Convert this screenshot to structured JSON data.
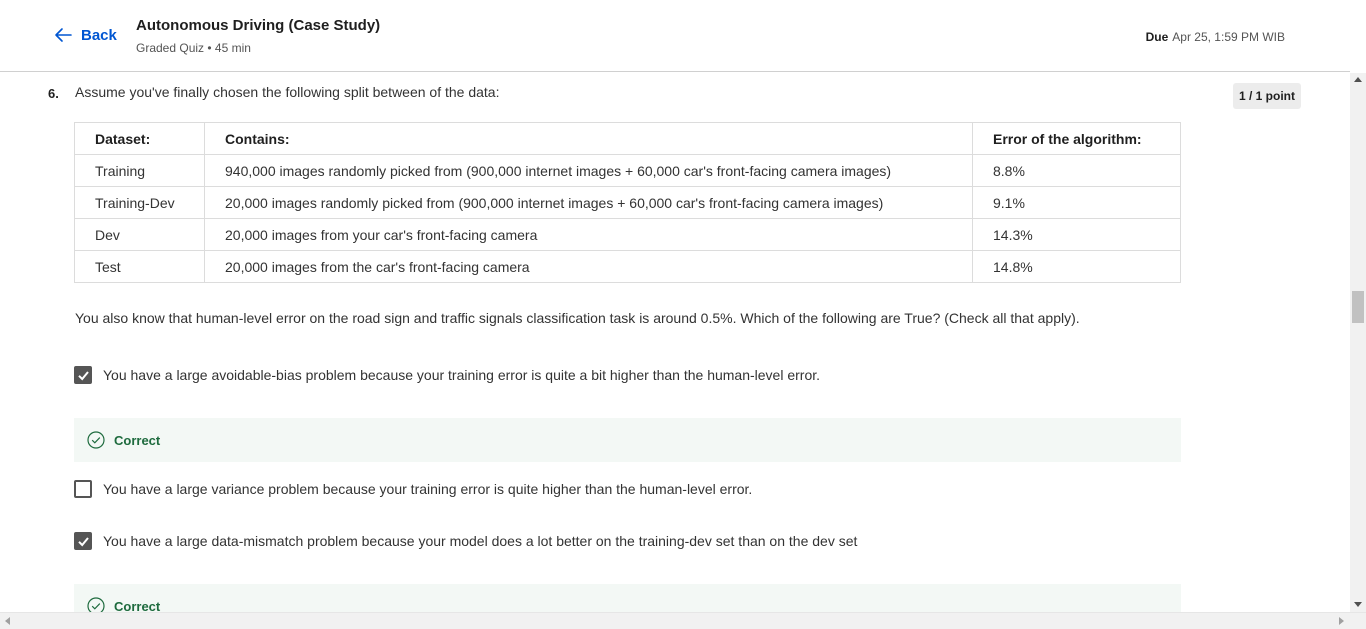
{
  "header": {
    "back_label": "Back",
    "title": "Autonomous Driving (Case Study)",
    "subtitle": "Graded Quiz • 45 min",
    "due_label": "Due",
    "due_value": "Apr 25, 1:59 PM WIB"
  },
  "question": {
    "number": "6.",
    "text": "Assume you've finally chosen the following split between of the data:",
    "points": "1 / 1 point",
    "table": {
      "headers": [
        "Dataset:",
        "Contains:",
        "Error of the algorithm:"
      ],
      "rows": [
        [
          "Training",
          "940,000 images randomly picked from (900,000 internet images + 60,000 car's front-facing camera images)",
          "8.8%"
        ],
        [
          "Training-Dev",
          "20,000 images randomly picked from (900,000 internet images + 60,000 car's front-facing camera images)",
          "9.1%"
        ],
        [
          "Dev",
          "20,000 images from your car's front-facing camera",
          "14.3%"
        ],
        [
          "Test",
          "20,000 images from the car's front-facing camera",
          "14.8%"
        ]
      ]
    },
    "followup": "You also know that human-level error on the road sign and traffic signals classification task is around 0.5%. Which of the following are True? (Check all that apply).",
    "options": [
      {
        "text": "You have a large avoidable-bias problem because your training error is quite a bit higher than the human-level error.",
        "checked": true
      },
      {
        "text": "You have a large variance problem because your training error is quite higher than the human-level error.",
        "checked": false
      },
      {
        "text": "You have a large data-mismatch problem because your model does a lot better on the training-dev set than on the dev set",
        "checked": true
      }
    ],
    "feedback_label": "Correct"
  },
  "colors": {
    "accent": "#0056d2",
    "correct": "#1e6b3e",
    "correct_bg": "#f3f8f5"
  },
  "icons": {
    "back": "arrow-left-icon",
    "correct": "check-circle-icon",
    "checkbox": "checkmark-icon"
  }
}
